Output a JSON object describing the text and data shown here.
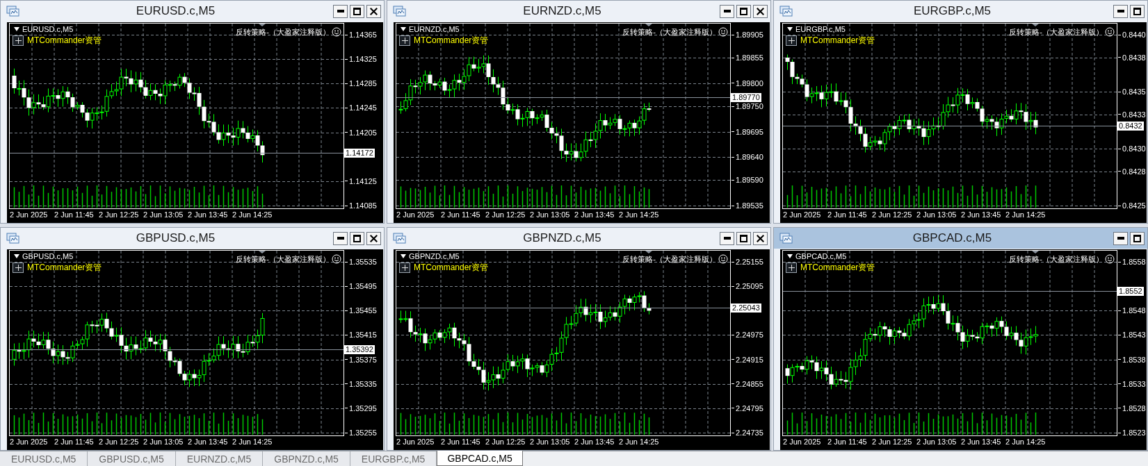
{
  "windows": [
    {
      "title": "EURUSD.c,M5",
      "active": false,
      "controls": [
        {
          "kind": "minimize"
        },
        {
          "kind": "maximize"
        },
        {
          "kind": "close"
        }
      ],
      "chart": {
        "symbol_label": "EURUSD.c,M5",
        "panel_label": "MTCommander资管",
        "expert_label": "反转策略-（大盈家注释版）",
        "price_ticks": [
          "1.14365",
          "1.14325",
          "1.14285",
          "1.14245",
          "1.14205",
          "1.14125",
          "1.14085"
        ],
        "current_price": "1.14172",
        "time_labels": [
          "2 Jun 2025",
          "2 Jun 11:45",
          "2 Jun 12:25",
          "2 Jun 13:05",
          "2 Jun 13:45",
          "2 Jun 14:25"
        ]
      }
    },
    {
      "title": "EURNZD.c,M5",
      "active": false,
      "controls": [
        {
          "kind": "minimize"
        },
        {
          "kind": "maximize"
        },
        {
          "kind": "close"
        }
      ],
      "chart": {
        "symbol_label": "EURNZD.c,M5",
        "panel_label": "MTCommander资管",
        "expert_label": "反转策略-（大盈家注释版）",
        "price_ticks": [
          "1.89905",
          "1.89855",
          "1.89800",
          "1.89750",
          "1.89695",
          "1.89640",
          "1.89590",
          "1.89535"
        ],
        "current_price": "1.89770",
        "time_labels": [
          "2 Jun 2025",
          "2 Jun 11:45",
          "2 Jun 12:25",
          "2 Jun 13:05",
          "2 Jun 13:45",
          "2 Jun 14:25"
        ]
      }
    },
    {
      "title": "EURGBP.c,M5",
      "active": false,
      "controls": [
        {
          "kind": "minimize"
        },
        {
          "kind": "maximize"
        }
      ],
      "chart": {
        "symbol_label": "EURGBP.c,M5",
        "panel_label": "MTCommander资管",
        "expert_label": "反转策略-（大盈家注释版）",
        "price_ticks": [
          "0.8440",
          "0.8438",
          "0.8435",
          "0.8433",
          "0.8430",
          "0.8428",
          "0.8425"
        ],
        "current_price": "0.8432",
        "time_labels": [
          "2 Jun 2025",
          "2 Jun 11:45",
          "2 Jun 12:25",
          "2 Jun 13:05",
          "2 Jun 13:45",
          "2 Jun 14:25"
        ]
      }
    },
    {
      "title": "GBPUSD.c,M5",
      "active": false,
      "controls": [
        {
          "kind": "minimize"
        },
        {
          "kind": "maximize"
        },
        {
          "kind": "close"
        }
      ],
      "chart": {
        "symbol_label": "GBPUSD.c,M5",
        "panel_label": "MTCommander资管",
        "expert_label": "反转策略-（大盈家注释版）",
        "price_ticks": [
          "1.35535",
          "1.35495",
          "1.35455",
          "1.35415",
          "1.35375",
          "1.35335",
          "1.35295",
          "1.35255"
        ],
        "current_price": "1.35392",
        "time_labels": [
          "2 Jun 2025",
          "2 Jun 11:45",
          "2 Jun 12:25",
          "2 Jun 13:05",
          "2 Jun 13:45",
          "2 Jun 14:25"
        ]
      }
    },
    {
      "title": "GBPNZD.c,M5",
      "active": false,
      "controls": [
        {
          "kind": "minimize"
        },
        {
          "kind": "maximize"
        },
        {
          "kind": "close"
        }
      ],
      "chart": {
        "symbol_label": "GBPNZD.c,M5",
        "panel_label": "MTCommander资管",
        "expert_label": "反转策略-（大盈家注释版）",
        "price_ticks": [
          "2.25155",
          "2.25095",
          "2.24975",
          "2.24915",
          "2.24855",
          "2.24795",
          "2.24735"
        ],
        "current_price": "2.25043",
        "time_labels": [
          "2 Jun 2025",
          "2 Jun 11:45",
          "2 Jun 12:25",
          "2 Jun 13:05",
          "2 Jun 13:45",
          "2 Jun 14:25"
        ]
      }
    },
    {
      "title": "GBPCAD.c,M5",
      "active": true,
      "controls": [
        {
          "kind": "minimize"
        },
        {
          "kind": "maximize"
        }
      ],
      "chart": {
        "symbol_label": "GBPCAD.c,M5",
        "panel_label": "MTCommander资管",
        "expert_label": "反转策略-（大盈家注释版）",
        "price_ticks": [
          "1.8558",
          "1.8548",
          "1.8543",
          "1.8538",
          "1.8533",
          "1.8528",
          "1.8523"
        ],
        "current_price": "1.8552",
        "time_labels": [
          "2 Jun 2025",
          "2 Jun 11:45",
          "2 Jun 12:25",
          "2 Jun 13:05",
          "2 Jun 13:45",
          "2 Jun 14:25"
        ]
      }
    }
  ],
  "tabs": [
    {
      "label": "EURUSD.c,M5",
      "selected": false
    },
    {
      "label": "GBPUSD.c,M5",
      "selected": false
    },
    {
      "label": "EURNZD.c,M5",
      "selected": false
    },
    {
      "label": "GBPNZD.c,M5",
      "selected": false
    },
    {
      "label": "EURGBP.c,M5",
      "selected": false
    },
    {
      "label": "GBPCAD.c,M5",
      "selected": true
    }
  ]
}
